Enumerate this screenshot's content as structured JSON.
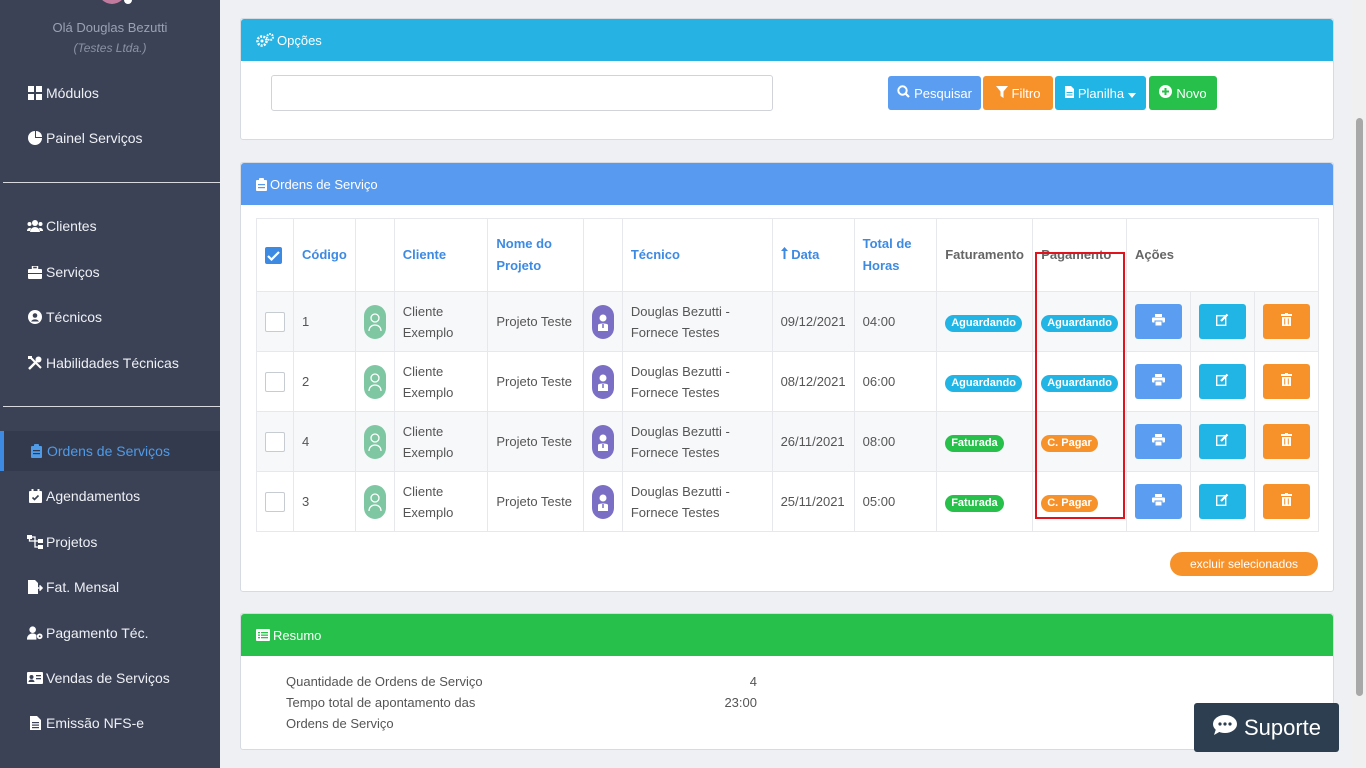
{
  "sidebar": {
    "greeting": "Olá Douglas Bezutti",
    "company": "(Testes Ltda.)",
    "items": [
      {
        "label": "Módulos",
        "icon": "grid-icon"
      },
      {
        "label": "Painel Serviços",
        "icon": "pie-chart-icon"
      },
      {
        "label": "Clientes",
        "icon": "users-icon"
      },
      {
        "label": "Serviços",
        "icon": "briefcase-icon"
      },
      {
        "label": "Técnicos",
        "icon": "user-circle-icon"
      },
      {
        "label": "Habilidades Técnicas",
        "icon": "tools-icon"
      },
      {
        "label": "Ordens de Serviços",
        "icon": "clipboard-icon"
      },
      {
        "label": "Agendamentos",
        "icon": "calendar-check-icon"
      },
      {
        "label": "Projetos",
        "icon": "sitemap-icon"
      },
      {
        "label": "Fat. Mensal",
        "icon": "file-export-icon"
      },
      {
        "label": "Pagamento Téc.",
        "icon": "user-cog-icon"
      },
      {
        "label": "Vendas de Serviços",
        "icon": "id-card-icon"
      },
      {
        "label": "Emissão NFS-e",
        "icon": "file-text-icon"
      }
    ]
  },
  "options": {
    "title": "Opções",
    "search_value": "",
    "btn_search": "Pesquisar",
    "btn_filter": "Filtro",
    "btn_sheet": "Planilha",
    "btn_new": "Novo"
  },
  "orders": {
    "title": "Ordens de Serviço",
    "headers": {
      "codigo": "Código",
      "cliente": "Cliente",
      "projeto": "Nome do Projeto",
      "tecnico": "Técnico",
      "data": "Data",
      "horas": "Total de Horas",
      "faturamento": "Faturamento",
      "pagamento": "Pagamento",
      "acoes": "Ações"
    },
    "rows": [
      {
        "codigo": "1",
        "cliente": "Cliente Exemplo",
        "projeto": "Projeto Teste",
        "tecnico": "Douglas Bezutti - Fornece Testes",
        "data": "09/12/2021",
        "horas": "04:00",
        "faturamento": "Aguardando",
        "pagamento": "Aguardando"
      },
      {
        "codigo": "2",
        "cliente": "Cliente Exemplo",
        "projeto": "Projeto Teste",
        "tecnico": "Douglas Bezutti - Fornece Testes",
        "data": "08/12/2021",
        "horas": "06:00",
        "faturamento": "Aguardando",
        "pagamento": "Aguardando"
      },
      {
        "codigo": "4",
        "cliente": "Cliente Exemplo",
        "projeto": "Projeto Teste",
        "tecnico": "Douglas Bezutti - Fornece Testes",
        "data": "26/11/2021",
        "horas": "08:00",
        "faturamento": "Faturada",
        "pagamento": "C. Pagar"
      },
      {
        "codigo": "3",
        "cliente": "Cliente Exemplo",
        "projeto": "Projeto Teste",
        "tecnico": "Douglas Bezutti - Fornece Testes",
        "data": "25/11/2021",
        "horas": "05:00",
        "faturamento": "Faturada",
        "pagamento": "C. Pagar"
      }
    ],
    "btn_delete_selected": "excluir selecionados"
  },
  "summary": {
    "title": "Resumo",
    "count_label": "Quantidade de Ordens de Serviço",
    "count_value": "4",
    "time_label_line1": "Tempo total de apontamento das",
    "time_label_line2": "Ordens de Serviço",
    "time_value": "23:00"
  },
  "support": {
    "label": "Suporte"
  },
  "colors": {
    "sidebar_bg": "#3b4256",
    "options_head": "#26b3e3",
    "orders_head": "#579af0",
    "summary_head": "#27c04b",
    "accent_blue": "#3d8ae3",
    "orange": "#f7922b"
  }
}
